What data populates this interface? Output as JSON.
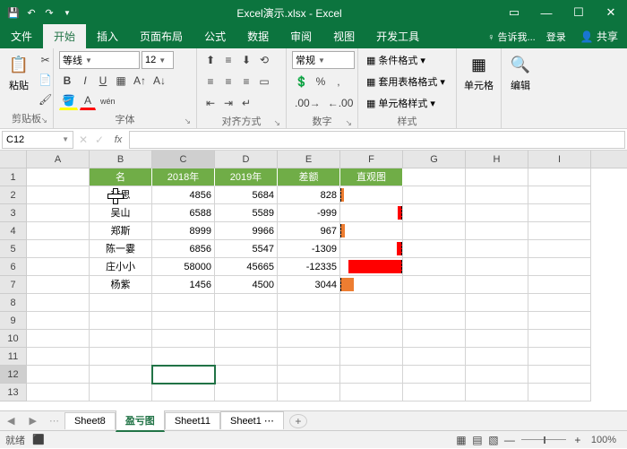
{
  "title": "Excel演示.xlsx - Excel",
  "tabs": {
    "file": "文件",
    "home": "开始",
    "insert": "插入",
    "layout": "页面布局",
    "formulas": "公式",
    "data": "数据",
    "review": "审阅",
    "view": "视图",
    "dev": "开发工具",
    "tell": "♀ 告诉我...",
    "login": "登录",
    "share": "共享"
  },
  "ribbon": {
    "clipboard": {
      "paste": "粘贴",
      "label": "剪贴板"
    },
    "font": {
      "name": "等线",
      "size": "12",
      "label": "字体"
    },
    "align": {
      "label": "对齐方式"
    },
    "number": {
      "format": "常规",
      "label": "数字"
    },
    "styles": {
      "cond": "条件格式",
      "table": "套用表格格式",
      "cell": "单元格样式",
      "label": "样式"
    },
    "cells": {
      "label": "单元格"
    },
    "editing": {
      "label": "编辑"
    }
  },
  "namebox": "C12",
  "cols": [
    "A",
    "B",
    "C",
    "D",
    "E",
    "F",
    "G",
    "H",
    "I"
  ],
  "header": {
    "b": "名",
    "c": "2018年",
    "d": "2019年",
    "e": "差额",
    "f": "直观图"
  },
  "rows": [
    {
      "name": "李思",
      "y18": 4856,
      "y19": 5684,
      "diff": 828
    },
    {
      "name": "吴山",
      "y18": 6588,
      "y19": 5589,
      "diff": -999
    },
    {
      "name": "郑斯",
      "y18": 8999,
      "y19": 9966,
      "diff": 967
    },
    {
      "name": "陈一霎",
      "y18": 6856,
      "y19": 5547,
      "diff": -1309
    },
    {
      "name": "庄小小",
      "y18": 58000,
      "y19": 45665,
      "diff": -12335
    },
    {
      "name": "杨紫",
      "y18": 1456,
      "y19": 4500,
      "diff": 3044
    }
  ],
  "chart_data": {
    "type": "bar",
    "title": "差额 直观图",
    "categories": [
      "李思",
      "吴山",
      "郑斯",
      "陈一霎",
      "庄小小",
      "杨紫"
    ],
    "values": [
      828,
      -999,
      967,
      -1309,
      -12335,
      3044
    ],
    "xlabel": "",
    "ylabel": "差额",
    "ylim": [
      -12335,
      3044
    ]
  },
  "sheets": {
    "s8": "Sheet8",
    "active": "盈亏图",
    "s11": "Sheet11",
    "s13": "Sheet1"
  },
  "status": {
    "ready": "就绪",
    "zoom": "100%"
  }
}
